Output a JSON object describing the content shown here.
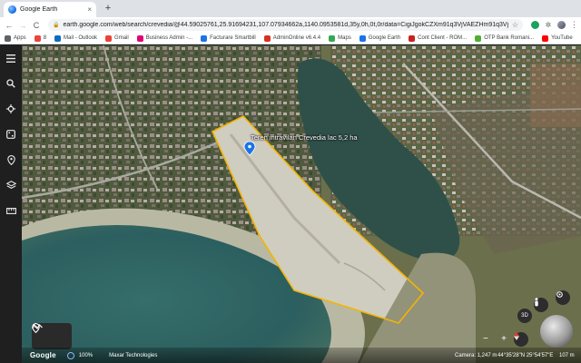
{
  "browser": {
    "tab_title": "Google Earth",
    "tab_close": "×",
    "new_tab": "+",
    "url": "earth.google.com/web/search/crevedia/@44.59025761,25.91694231,107.07934662a,1140.0953581d,35y,0h,0t,0r/data=CigiJgokCZXm91q3VjVAEZHm91q3VjVAGUQo...",
    "nav": {
      "back": "←",
      "forward": "→",
      "reload": "C"
    },
    "lock_icon": "🔒",
    "star_icon": "☆",
    "puzzle_icon": "✲",
    "menu_icon": "⋮"
  },
  "bookmarks": [
    {
      "label": "Apps",
      "color": "#5f6368",
      "icon": "apps-icon"
    },
    {
      "label": "8",
      "color": "#e8453c",
      "icon": "bookmark-8-icon"
    },
    {
      "label": "Mail - Outlook",
      "color": "#0f6cbd",
      "icon": "outlook-icon"
    },
    {
      "label": "Gmail",
      "color": "#ea4335",
      "icon": "gmail-icon"
    },
    {
      "label": "Business Admin -...",
      "color": "#e20074",
      "icon": "telekom-icon"
    },
    {
      "label": "Facturare Smartbill",
      "color": "#1a73e8",
      "icon": "smartbill-icon"
    },
    {
      "label": "AdminOnline v6.4.4",
      "color": "#d93025",
      "icon": "adminonline-icon"
    },
    {
      "label": "Maps",
      "color": "#34a853",
      "icon": "maps-icon"
    },
    {
      "label": "Google Earth",
      "color": "#1a73e8",
      "icon": "earth-icon"
    },
    {
      "label": "Cont Client - ROM...",
      "color": "#c5221f",
      "icon": "rom-icon"
    },
    {
      "label": "OTP Bank Romani...",
      "color": "#52ae30",
      "icon": "otp-icon"
    },
    {
      "label": "YouTube",
      "color": "#ff0000",
      "icon": "youtube-icon"
    }
  ],
  "map": {
    "placemark_label": "Teren intravilan Crevedia lac 5,2 ha",
    "polygon_color": "#f5b400",
    "placemark_color": "#1a73e8"
  },
  "status": {
    "logo": "Google",
    "zoom": "100%",
    "provider": "Maxar Technologies",
    "camera": "Camera: 1,247 m",
    "coords": "44°35'28\"N 25°54'57\"E",
    "altitude": "107 m"
  },
  "controls": {
    "view_3d": "3D",
    "zoom_out": "−",
    "zoom_in": "+"
  }
}
